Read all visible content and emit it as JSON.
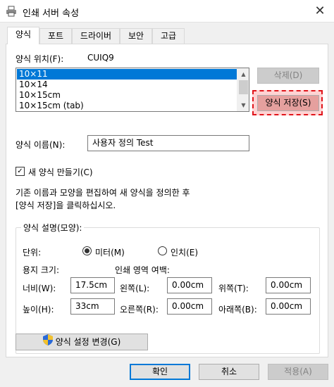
{
  "window": {
    "title": "인쇄 서버 속성",
    "close": "✕"
  },
  "tabs": [
    "양식",
    "포트",
    "드라이버",
    "보안",
    "고급"
  ],
  "form_location": {
    "label": "양식 위치(F):",
    "value": "CUIQ9"
  },
  "list": {
    "items": [
      "10×11",
      "10×14",
      "10×15cm",
      "10×15cm (tab)"
    ],
    "selected": "10×11"
  },
  "buttons": {
    "delete": "삭제(D)",
    "save_form": "양식 저장(S)",
    "change_settings": "양식 설정 변경(G)",
    "ok": "확인",
    "cancel": "취소",
    "apply": "적용(A)"
  },
  "form_name": {
    "label": "양식 이름(N):",
    "value": "사용자 정의 Test"
  },
  "new_form": {
    "label": "새 양식 만들기(C)",
    "checked": true
  },
  "instructions": [
    "기존 이름과 모양을 편집하여 새 양식을 정의한 후",
    "[양식 저장]을 클릭하십시오."
  ],
  "description": {
    "legend": "양식 설명(모양):",
    "units_label": "단위:",
    "unit_metric": "미터(M)",
    "unit_inch": "인치(E)",
    "paper_size_label": "용지 크기:",
    "margins_label": "인쇄 영역 여백:",
    "width_label": "너비(W):",
    "width_value": "17.5cm",
    "height_label": "높이(H):",
    "height_value": "33cm",
    "left_label": "왼쪽(L):",
    "left_value": "0.00cm",
    "right_label": "오른쪽(R):",
    "right_value": "0.00cm",
    "top_label": "위쪽(T):",
    "top_value": "0.00cm",
    "bottom_label": "아래쪽(B):",
    "bottom_value": "0.00cm"
  },
  "colors": {
    "selection": "#0078d7",
    "highlight_border": "#e0141a",
    "save_button": "#e5a09e"
  }
}
